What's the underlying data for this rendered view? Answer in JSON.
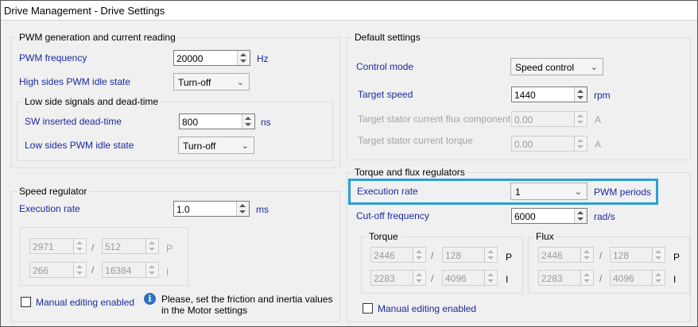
{
  "window": {
    "title": "Drive Management - Drive Settings"
  },
  "pwm": {
    "title": "PWM generation and current reading",
    "freq_label": "PWM frequency",
    "freq_value": "20000",
    "freq_unit": "Hz",
    "high_idle_label": "High sides PWM idle state",
    "high_idle_value": "Turn-off",
    "low": {
      "title": "Low side signals and dead-time",
      "dead_label": "SW inserted dead-time",
      "dead_value": "800",
      "dead_unit": "ns",
      "idle_label": "Low sides PWM idle state",
      "idle_value": "Turn-off"
    }
  },
  "defaults": {
    "title": "Default settings",
    "control_label": "Control mode",
    "control_value": "Speed control",
    "speed_label": "Target speed",
    "speed_value": "1440",
    "speed_unit": "rpm",
    "flux_label": "Target stator current flux component",
    "flux_value": "0.00",
    "flux_unit": "A",
    "torque_label": "Target stator current torque",
    "torque_value": "0.00",
    "torque_unit": "A"
  },
  "speed_reg": {
    "title": "Speed regulator",
    "exec_label": "Execution rate",
    "exec_value": "1.0",
    "exec_unit": "ms",
    "p_num": "2971",
    "p_den": "512",
    "p_label": "P",
    "i_num": "266",
    "i_den": "16384",
    "i_label": "I",
    "slash": "/",
    "manual_label": "Manual editing enabled",
    "info_icon": "i",
    "info_text_1": "Please, set the friction and inertia values",
    "info_text_2": "in the Motor settings"
  },
  "tf_reg": {
    "title": "Torque and flux regulators",
    "exec_label": "Execution rate",
    "exec_value": "1",
    "exec_unit": "PWM periods",
    "cutoff_label": "Cut-off frequency",
    "cutoff_value": "6000",
    "cutoff_unit": "rad/s",
    "torque": {
      "title": "Torque",
      "p_num": "2446",
      "p_den": "128",
      "p_label": "P",
      "i_num": "2283",
      "i_den": "4096",
      "i_label": "I"
    },
    "flux": {
      "title": "Flux",
      "p_num": "2446",
      "p_den": "128",
      "p_label": "P",
      "i_num": "2283",
      "i_den": "4096",
      "i_label": "I"
    },
    "slash": "/",
    "manual_label": "Manual editing enabled"
  },
  "colors": {
    "label_blue": "#1c2aa0",
    "highlight": "#2a9ed6",
    "disabled_text": "#a3a3a3"
  }
}
